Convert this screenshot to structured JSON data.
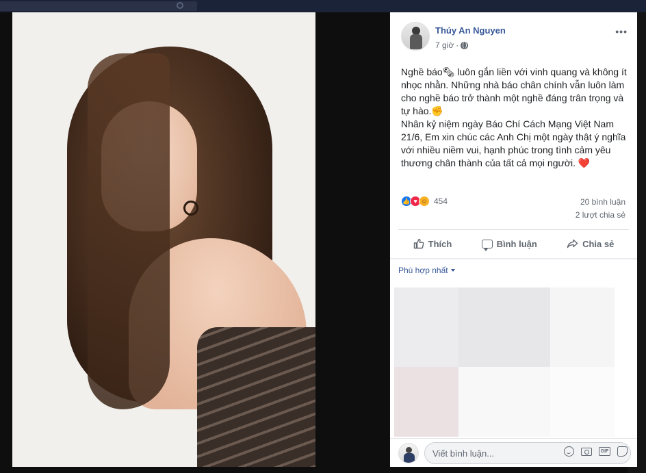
{
  "post": {
    "author": "Thúy An Nguyen",
    "time": "7 giờ",
    "more": "•••",
    "text": "Nghề báo🗞 luôn gắn liền với vinh quang và không ít nhọc nhằn. Những nhà báo chân chính vẫn luôn làm cho nghề báo trở thành một nghề đáng trân trọng và tự hào.✊\nNhân kỷ niệm ngày Báo Chí Cách Mạng Việt Nam 21/6, Em xin chúc các Anh Chị một ngày thật ý nghĩa với nhiều niềm vui, hạnh phúc trong tình cảm yêu thương chân thành của tất cả mọi người. ❤️",
    "reactions": {
      "like_icon": "👍",
      "love_icon": "♥",
      "care_icon": "☺",
      "count": "454"
    },
    "comments_count": "20 bình luận",
    "shares_count": "2 lượt chia sẻ"
  },
  "actions": {
    "like": "Thích",
    "comment": "Bình luận",
    "share": "Chia sẻ"
  },
  "sort": {
    "label": "Phù hợp nhất"
  },
  "composer": {
    "placeholder": "Viết bình luận..."
  },
  "colors": {
    "link": "#385898",
    "secondary_text": "#606770",
    "like": "#1877f2",
    "love": "#f0284a",
    "care": "#f7b125"
  },
  "icons": {
    "globe": "globe-icon",
    "like": "thumbs-up-icon",
    "comment": "comment-bubble-icon",
    "share": "share-arrow-icon",
    "sort": "caret-down-icon",
    "emoji": "smile-icon",
    "camera": "camera-icon",
    "gif": "gif-icon",
    "sticker": "sticker-icon"
  }
}
